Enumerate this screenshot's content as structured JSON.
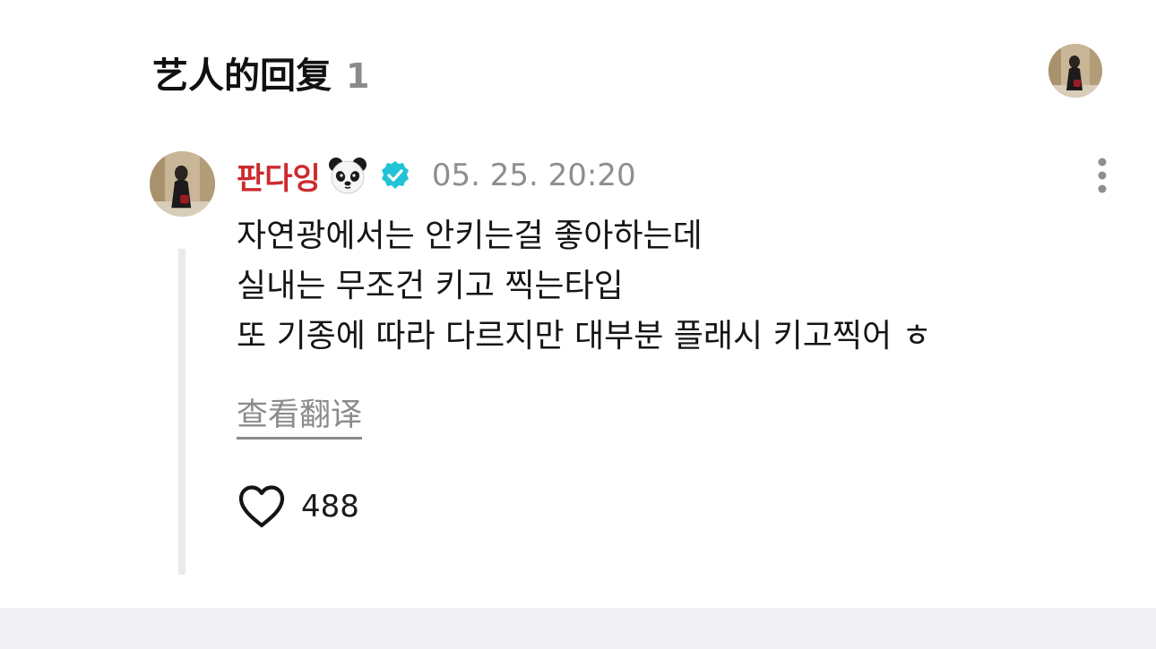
{
  "header": {
    "title": "艺人的回复",
    "count": "1",
    "avatar_icon": "profile-photo"
  },
  "comment": {
    "username": "판다잉",
    "username_color": "#cc2a2f",
    "emoji_icon": "panda-face-icon",
    "verified_icon": "verified-badge-icon",
    "verified_color": "#22c3d6",
    "timestamp": "05. 25. 20:20",
    "lines": [
      "자연광에서는 안키는걸 좋아하는데",
      "실내는 무조건 키고 찍는타입",
      "또 기종에 따라 다르지만 대부분 플래시 키고찍어 ㅎ"
    ],
    "translate_label": "查看翻译",
    "like_icon": "heart-outline-icon",
    "like_count": "488",
    "more_icon": "vertical-ellipsis-icon"
  }
}
